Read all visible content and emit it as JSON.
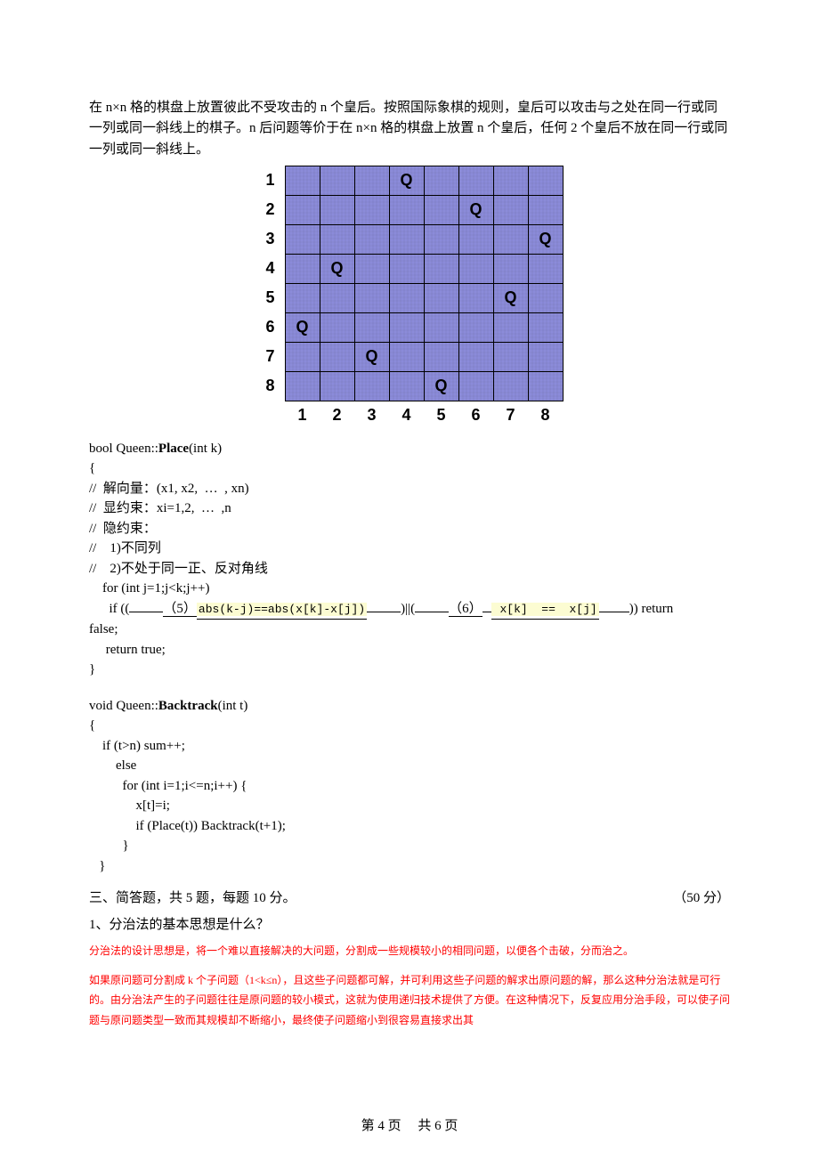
{
  "intro": "在 n×n 格的棋盘上放置彼此不受攻击的 n 个皇后。按照国际象棋的规则，皇后可以攻击与之处在同一行或同一列或同一斜线上的棋子。n 后问题等价于在 n×n 格的棋盘上放置 n 个皇后，任何 2 个皇后不放在同一行或同一列或同一斜线上。",
  "board": {
    "size": 8,
    "rows": [
      "1",
      "2",
      "3",
      "4",
      "5",
      "6",
      "7",
      "8"
    ],
    "cols": [
      "1",
      "2",
      "3",
      "4",
      "5",
      "6",
      "7",
      "8"
    ],
    "queen_label": "Q",
    "queen_positions": [
      {
        "r": 1,
        "c": 4
      },
      {
        "r": 2,
        "c": 6
      },
      {
        "r": 3,
        "c": 8
      },
      {
        "r": 4,
        "c": 2
      },
      {
        "r": 5,
        "c": 7
      },
      {
        "r": 6,
        "c": 1
      },
      {
        "r": 7,
        "c": 3
      },
      {
        "r": 8,
        "c": 5
      }
    ]
  },
  "code": {
    "l1a": "bool Queen::",
    "l1b": "Place",
    "l1c": "(int k)",
    "l2": "{",
    "l3": "//  解向量：(x1, x2,  …  , xn)",
    "l4": "//  显约束：xi=1,2,  …  ,n",
    "l5": "//  隐约束：",
    "l6": "//    1)不同列",
    "l7": "//    2)不处于同一正、反对角线",
    "l8": "    for (int j=1;j<k;j++)",
    "l9a": "      if ((",
    "blank5_label": "（5）",
    "blank5_ans": "abs(k-j)==abs(x[k]-x[j])",
    "l9b": ")||(",
    "blank6_label": "（6）",
    "blank6_ans": " x[k]  ==  x[j]",
    "l9c": ")) return",
    "l10": "false;",
    "l11": "     return true;",
    "l12": "}",
    "l13": "",
    "l14a": "void Queen::",
    "l14b": "Backtrack",
    "l14c": "(int t)",
    "l15": "{",
    "l16": "    if (t>n) sum++;",
    "l17": "        else",
    "l18": "          for (int i=1;i<=n;i++) {",
    "l19": "              x[t]=i;",
    "l20": "              if (Place(t)) Backtrack(t+1);",
    "l21": "          }",
    "l22": "   }"
  },
  "section3": {
    "title": "三、简答题，共 5 题，每题 10 分。",
    "score": "（50 分）"
  },
  "q1": "1、分治法的基本思想是什么？",
  "ans_p1": "分治法的设计思想是，将一个难以直接解决的大问题，分割成一些规模较小的相同问题，以便各个击破，分而治之。",
  "ans_p2": "如果原问题可分割成 k 个子问题（1<k≤n），且这些子问题都可解，并可利用这些子问题的解求出原问题的解，那么这种分治法就是可行的。由分治法产生的子问题往往是原问题的较小模式，这就为使用递归技术提供了方便。在这种情况下，反复应用分治手段，可以使子问题与原问题类型一致而其规模却不断缩小，最终使子问题缩小到很容易直接求出其",
  "footer": {
    "left": "第 4 页",
    "right": "共 6 页"
  }
}
